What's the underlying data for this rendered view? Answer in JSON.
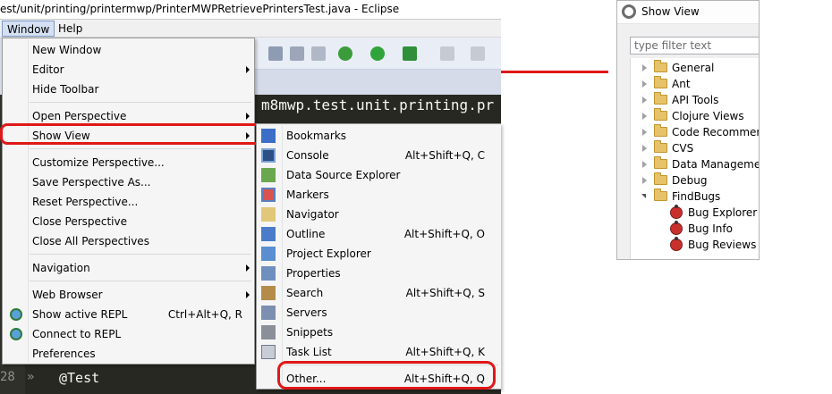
{
  "window_title": "est/unit/printing/printermwp/PrinterMWPRetrievePrintersTest.java - Eclipse",
  "menubar": {
    "window": "Window",
    "help": "Help"
  },
  "editor": {
    "package_text": "m8mwp.test.unit.printing.pr",
    "line_number": "28",
    "fold_marker": "»",
    "annotation": "@Test"
  },
  "window_menu": {
    "items": [
      {
        "label": "New Window"
      },
      {
        "label": "Editor",
        "submenu": true
      },
      {
        "label": "Hide Toolbar"
      },
      {
        "label": "Open Perspective",
        "submenu": true
      },
      {
        "label": "Show View",
        "submenu": true,
        "highlighted": true
      },
      {
        "label": "Customize Perspective..."
      },
      {
        "label": "Save Perspective As..."
      },
      {
        "label": "Reset Perspective..."
      },
      {
        "label": "Close Perspective"
      },
      {
        "label": "Close All Perspectives"
      },
      {
        "label": "Navigation",
        "submenu": true
      },
      {
        "label": "Web Browser",
        "submenu": true
      },
      {
        "label": "Show active REPL",
        "accelerator": "Ctrl+Alt+Q, R",
        "icon": "repl-icon"
      },
      {
        "label": "Connect to REPL",
        "icon": "connect-repl-icon"
      },
      {
        "label": "Preferences"
      }
    ]
  },
  "show_view_menu": {
    "items": [
      {
        "label": "Bookmarks",
        "icon": "bookmarks-icon"
      },
      {
        "label": "Console",
        "accelerator": "Alt+Shift+Q, C",
        "icon": "console-icon"
      },
      {
        "label": "Data Source Explorer",
        "icon": "data-source-icon"
      },
      {
        "label": "Markers",
        "icon": "markers-icon"
      },
      {
        "label": "Navigator",
        "icon": "navigator-icon"
      },
      {
        "label": "Outline",
        "accelerator": "Alt+Shift+Q, O",
        "icon": "outline-icon"
      },
      {
        "label": "Project Explorer",
        "icon": "project-explorer-icon"
      },
      {
        "label": "Properties",
        "icon": "properties-icon"
      },
      {
        "label": "Search",
        "accelerator": "Alt+Shift+Q, S",
        "icon": "search-icon"
      },
      {
        "label": "Servers",
        "icon": "servers-icon"
      },
      {
        "label": "Snippets",
        "icon": "snippets-icon"
      },
      {
        "label": "Task List",
        "accelerator": "Alt+Shift+Q, K",
        "icon": "task-list-icon"
      },
      {
        "label": "Other...",
        "accelerator": "Alt+Shift+Q, Q",
        "highlighted": true
      }
    ]
  },
  "dialog": {
    "title": "Show View",
    "filter_placeholder": "type filter text",
    "tree": [
      {
        "label": "General",
        "expanded": false
      },
      {
        "label": "Ant",
        "expanded": false
      },
      {
        "label": "API Tools",
        "expanded": false
      },
      {
        "label": "Clojure Views",
        "expanded": false
      },
      {
        "label": "Code Recommend",
        "expanded": false
      },
      {
        "label": "CVS",
        "expanded": false
      },
      {
        "label": "Data Management",
        "expanded": false
      },
      {
        "label": "Debug",
        "expanded": false
      },
      {
        "label": "FindBugs",
        "expanded": true,
        "children": [
          "Bug Explorer",
          "Bug Info",
          "Bug Reviews"
        ]
      }
    ]
  },
  "colors": {
    "highlight_red": "#e01818",
    "editor_bg": "#272822",
    "menu_bg": "#f5f5f5"
  }
}
